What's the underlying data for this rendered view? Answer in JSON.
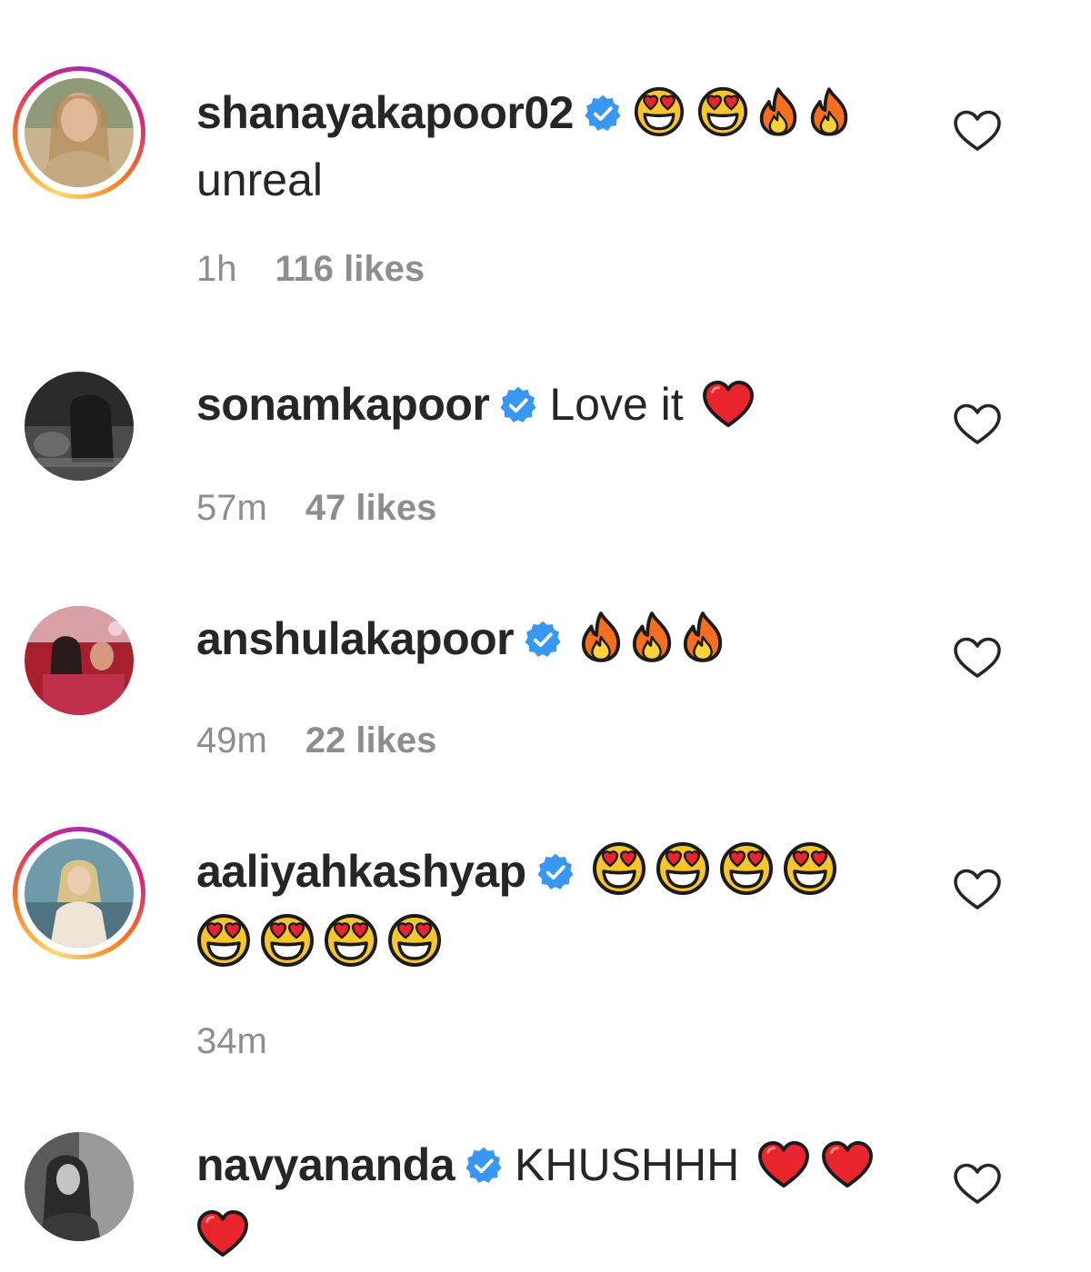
{
  "comments": [
    {
      "username": "shanayakapoor02",
      "verified": true,
      "story_ring": true,
      "emoji_line1": [
        "heart-eyes",
        "heart-eyes",
        "fire",
        "fire"
      ],
      "text": "unreal",
      "time": "1h",
      "likes": "116 likes"
    },
    {
      "username": "sonamkapoor",
      "verified": true,
      "story_ring": false,
      "text": "Love it",
      "emoji_line1": [
        "red-heart"
      ],
      "time": "57m",
      "likes": "47 likes"
    },
    {
      "username": "anshulakapoor",
      "verified": true,
      "story_ring": false,
      "emoji_line1": [
        "fire",
        "fire",
        "fire"
      ],
      "time": "49m",
      "likes": "22 likes"
    },
    {
      "username": "aaliyahkashyap",
      "verified": true,
      "story_ring": true,
      "emoji_line1": [
        "heart-eyes",
        "heart-eyes",
        "heart-eyes",
        "heart-eyes"
      ],
      "emoji_line2": [
        "heart-eyes",
        "heart-eyes",
        "heart-eyes",
        "heart-eyes"
      ],
      "time": "34m"
    },
    {
      "username": "navyananda",
      "verified": true,
      "story_ring": false,
      "text": "KHUSHHH",
      "emoji_line1": [
        "red-heart",
        "red-heart"
      ],
      "emoji_line2": [
        "red-heart"
      ]
    }
  ],
  "colors": {
    "verified_blue": "#3897f0",
    "meta_gray": "#8e8e8e",
    "text_dark": "#262626"
  },
  "icons": {
    "like": "heart-outline-icon",
    "verified": "verified-badge-icon"
  }
}
